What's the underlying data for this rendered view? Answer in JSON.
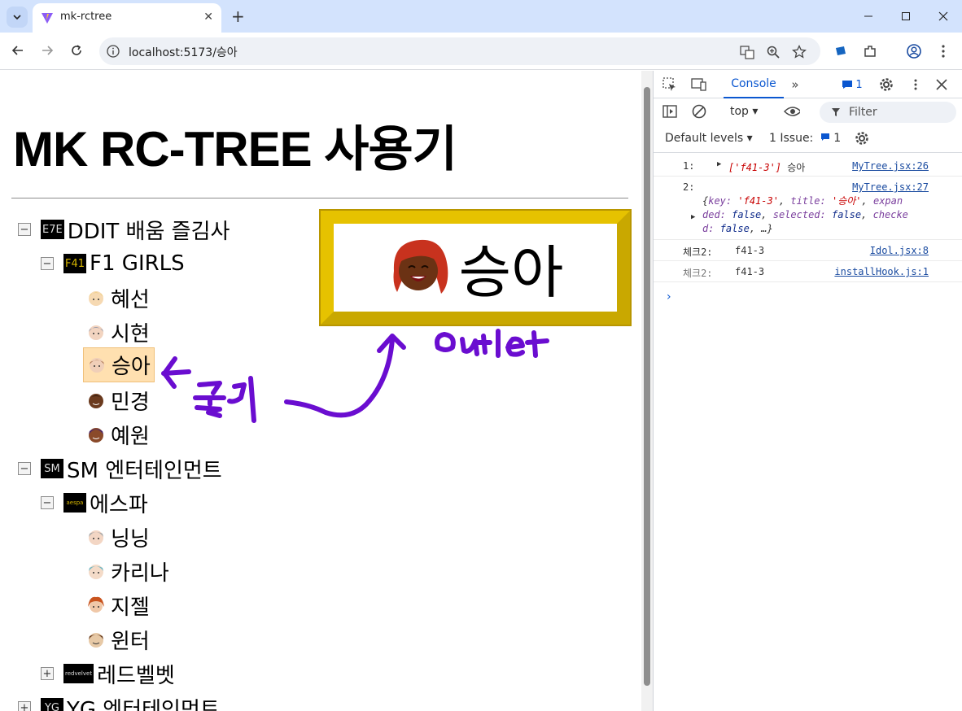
{
  "browser": {
    "tab_title": "mk-rctree",
    "new_tab": "+",
    "url": "localhost:5173/승아"
  },
  "page": {
    "title": "MK RC-TREE 사용기",
    "tree": {
      "n1": {
        "badge": "E7E",
        "label": "DDIT 배움 즐김사",
        "switcher": "−"
      },
      "n2": {
        "badge": "F41",
        "label": "F1 GIRLS",
        "switcher": "−"
      },
      "n3": {
        "label": "혜선",
        "avatar": "avatar-hyeseon-icon"
      },
      "n4": {
        "label": "시현",
        "avatar": "avatar-sihyeon-icon"
      },
      "n5": {
        "label": "승아",
        "avatar": "avatar-seunga-icon"
      },
      "n6": {
        "label": "민경",
        "avatar": "avatar-mingyeong-icon"
      },
      "n7": {
        "label": "예원",
        "avatar": "avatar-yewon-icon"
      },
      "n8": {
        "badge": "SM",
        "label": "SM 엔터테인먼트",
        "switcher": "−"
      },
      "n9": {
        "badge": "aespa",
        "label": "에스파",
        "switcher": "−"
      },
      "n10": {
        "label": "닝닝",
        "avatar": "avatar-ningning-icon"
      },
      "n11": {
        "label": "카리나",
        "avatar": "avatar-karina-icon"
      },
      "n12": {
        "label": "지젤",
        "avatar": "avatar-giselle-icon"
      },
      "n13": {
        "label": "윈터",
        "avatar": "avatar-winter-icon"
      },
      "n14": {
        "badge": "redvelvet",
        "label": "레드벨벳",
        "switcher": "+"
      },
      "n15": {
        "badge": "YG",
        "label": "YG 엔터테인먼트",
        "switcher": "+"
      }
    },
    "selected": "승아",
    "outlet": {
      "name": "승아"
    },
    "annotations": {
      "click": "← 클릭",
      "outlet": "Outlet"
    }
  },
  "devtools": {
    "active_tab": "Console",
    "more_tabs": "»",
    "message_count": "1",
    "context": "top ▾",
    "filter_placeholder": "Filter",
    "levels": "Default levels ▾",
    "issues_label": "1 Issue:",
    "issues_count": "1",
    "logs": {
      "l1": {
        "prefix": "1:",
        "value": "['f41-3']",
        "text": "승아",
        "source": "MyTree.jsx:26"
      },
      "l2": {
        "prefix": "2:",
        "source": "MyTree.jsx:27",
        "k1": "key:",
        "v1": "'f41-3'",
        "k2": "title:",
        "v2": "'승아'",
        "k3": "expan",
        "k3b": "ded:",
        "v3": "false",
        "k4": "selected:",
        "v4": "false",
        "k5": "checke",
        "k5b": "d:",
        "v5": "false",
        "rest": "…}"
      },
      "l3": {
        "label": "체크2:",
        "value": "f41-3",
        "source": "Idol.jsx:8"
      },
      "l4": {
        "label": "체크2:",
        "value": "f41-3",
        "source": "installHook.js:1"
      }
    },
    "prompt": "›"
  },
  "colors": {
    "selected_bg": "#ffe0b0",
    "outlet_frame": "#e6c200",
    "annotation": "#6a0dd0",
    "devtools_blue": "#0b57d0"
  }
}
